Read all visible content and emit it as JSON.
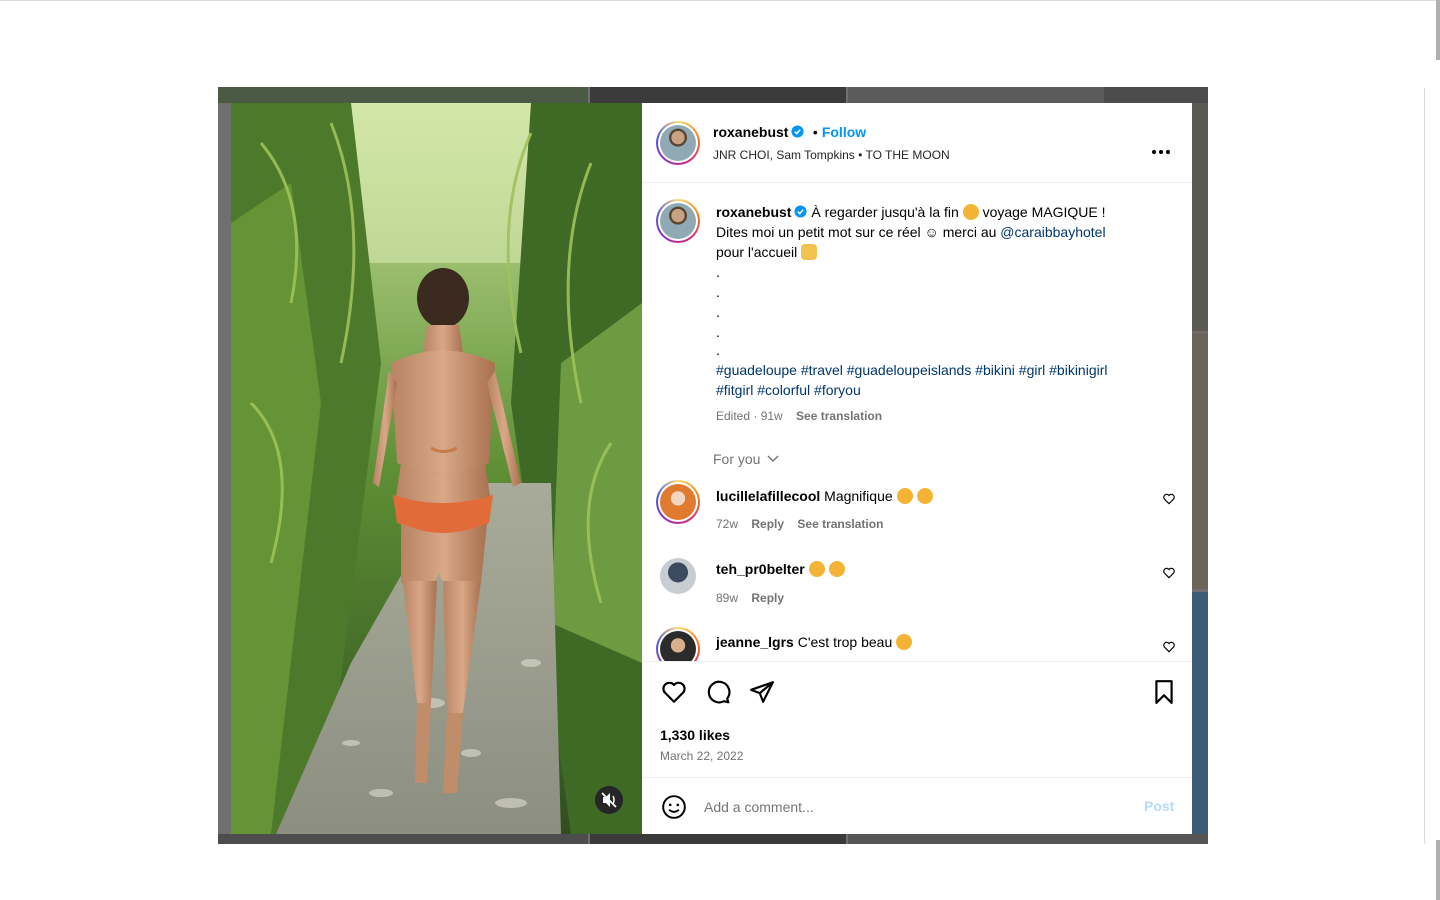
{
  "post": {
    "author": "roxanebust",
    "follow_label": "Follow",
    "separator": "•",
    "audio": "JNR CHOI, Sam Tompkins • TO THE MOON",
    "caption": {
      "line1": "À regarder jusqu'à la fin",
      "line1b": "voyage MAGIQUE !",
      "line2": "Dites moi un petit mot sur ce réel ☺ merci au",
      "mention": "@caraibbayhotel",
      "line3": "pour l'accueil",
      "dots": [
        ".",
        ".",
        ".",
        ".",
        "."
      ],
      "hashtags_line1": "#guadeloupe #travel #guadeloupeislands #bikini #girl #bikinigirl",
      "hashtags_line2": "#fitgirl #colorful #foryou"
    },
    "edited": "Edited · 91w",
    "see_translation": "See translation",
    "for_you": "For you",
    "likes": "1,330 likes",
    "date": "March 22, 2022",
    "comment_placeholder": "Add a comment...",
    "post_label": "Post"
  },
  "comments": [
    {
      "user": "lucillelafillecool",
      "text": "Magnifique",
      "age": "72w",
      "reply": "Reply",
      "translate": "See translation"
    },
    {
      "user": "teh_pr0belter",
      "text": "",
      "age": "89w",
      "reply": "Reply"
    },
    {
      "user": "jeanne_lgrs",
      "text": "C'est trop beau"
    }
  ],
  "colors": {
    "accent": "#0095f6",
    "link": "#00376b",
    "muted": "#737373",
    "verified": "#0095f6"
  },
  "icons": [
    "more-icon",
    "heart-icon",
    "comment-icon",
    "share-icon",
    "save-icon",
    "emoji-icon",
    "muted-audio-icon",
    "verified-badge-icon",
    "chevron-down-icon"
  ]
}
